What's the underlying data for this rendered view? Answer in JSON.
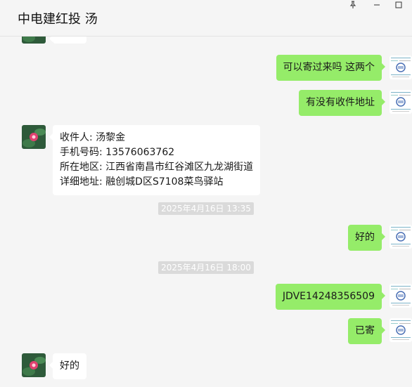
{
  "window": {
    "title": "中电建红投 汤",
    "pin_icon": "pin-icon",
    "min_icon": "minimize-icon",
    "max_icon": "maximize-icon"
  },
  "messages": [
    {
      "type": "outgoing",
      "text": "可以寄过来吗 这两个"
    },
    {
      "type": "outgoing",
      "text": "有没有收件地址"
    },
    {
      "type": "incoming",
      "lines": [
        "收件人: 汤黎金",
        "手机号码: 13576063762",
        "所在地区: 江西省南昌市红谷滩区九龙湖街道",
        "详细地址: 融创城D区S7108菜鸟驿站"
      ]
    },
    {
      "type": "timestamp",
      "text": "2025年4月16日 13:35"
    },
    {
      "type": "outgoing",
      "text": "好的"
    },
    {
      "type": "timestamp",
      "text": "2025年4月16日 18:00"
    },
    {
      "type": "outgoing",
      "text": "JDVE14248356509"
    },
    {
      "type": "outgoing",
      "text": "已寄"
    },
    {
      "type": "incoming",
      "text": "好的"
    }
  ],
  "colors": {
    "outgoing_bubble": "#95ec69",
    "incoming_bubble": "#ffffff",
    "background": "#f5f5f5"
  }
}
